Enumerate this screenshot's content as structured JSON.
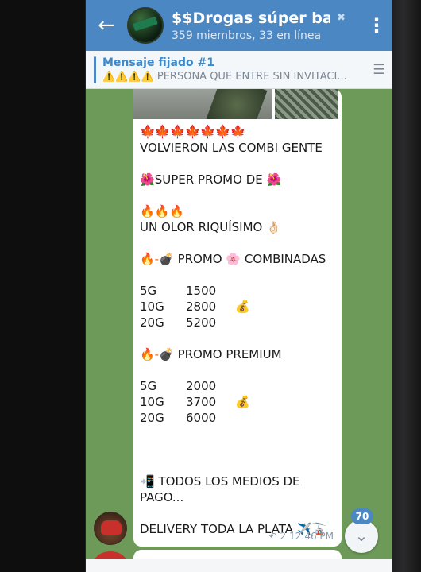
{
  "header": {
    "back_icon": "arrow-left-icon",
    "title": "$$Drogas súper barat...",
    "subtitle": "359 miembros, 33 en línea",
    "menu_icon": "dots-vertical-icon"
  },
  "pinned": {
    "title": "Mensaje fijado #1",
    "text": "⚠️⚠️⚠️⚠️ PERSONA QUE ENTRE SIN INVITACI..."
  },
  "message": {
    "leaves": "🍁🍁🍁🍁🍁🍁🍁",
    "line1": "VOLVIERON LAS COMBI GENTE",
    "promo_flower": "🌺",
    "promo_line": "SUPER PROMO DE",
    "fires": "🔥🔥🔥",
    "olor": "UN OLOR RIQUÍSIMO",
    "ok_hand": "👌🏻",
    "fire_bomb": "🔥-💣",
    "promo": "PROMO",
    "sakura": "🌸",
    "combinadas": "COMBINADAS",
    "combinadas_prices": [
      {
        "qty": "5G",
        "price": "1500",
        "money": ""
      },
      {
        "qty": "10G",
        "price": "2800",
        "money": "💰"
      },
      {
        "qty": "20G",
        "price": "5200",
        "money": ""
      }
    ],
    "premium": "PROMO PREMIUM",
    "premium_prices": [
      {
        "qty": "5G",
        "price": "2000",
        "money": ""
      },
      {
        "qty": "10G",
        "price": "3700",
        "money": "💰"
      },
      {
        "qty": "20G",
        "price": "6000",
        "money": ""
      }
    ],
    "phone": "📲",
    "pago_line1": "TODOS LOS MEDIOS DE",
    "pago_line2": "PAGO...",
    "delivery": "DELIVERY TODA LA PLATA",
    "delivery_emoji": "✈️🚡",
    "replies": "2",
    "time": "12:46 PM"
  },
  "scroll": {
    "badge_count": "70",
    "down_icon": "chevron-down-icon"
  }
}
